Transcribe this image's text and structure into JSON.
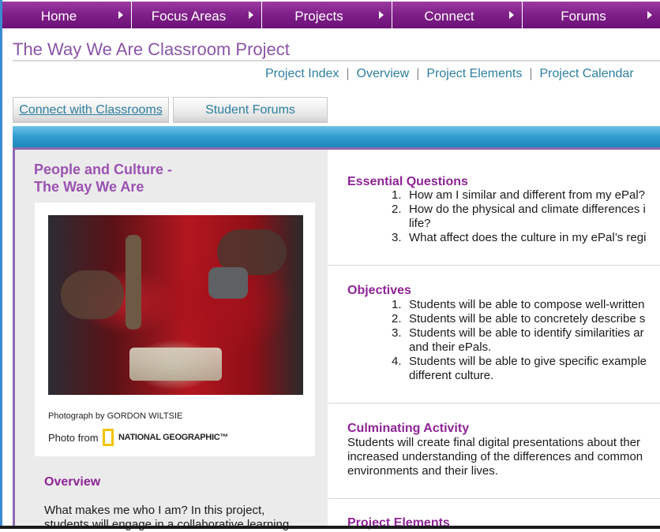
{
  "nav": {
    "items": [
      {
        "label": "Home"
      },
      {
        "label": "Focus Areas"
      },
      {
        "label": "Projects"
      },
      {
        "label": "Connect"
      },
      {
        "label": "Forums"
      }
    ]
  },
  "page": {
    "title": "The Way We Are Classroom Project"
  },
  "subnav": [
    "Project Index",
    "Overview",
    "Project Elements",
    "Project Calendar"
  ],
  "subnav_separator": "|",
  "tabs": [
    "Connect with Classrooms",
    "Student Forums"
  ],
  "left": {
    "heading_line1": "People and Culture -",
    "heading_line2": "The Way We Are",
    "photo_credit": "Photograph by GORDON WILTSIE",
    "photo_from": "Photo from",
    "logo_text": "NATIONAL GEOGRAPHIC™",
    "overview_heading": "Overview",
    "overview_text": "What makes me who I am? In this project, students will engage in a collaborative learning"
  },
  "right": {
    "essential": {
      "heading": "Essential Questions",
      "items": [
        {
          "num": "1.",
          "text": "How am I similar and different from my ePal?"
        },
        {
          "num": "2.",
          "text": "How do the physical and climate differences i",
          "cont": "life?"
        },
        {
          "num": "3.",
          "text": "What affect does the culture in my ePal’s regi"
        }
      ]
    },
    "objectives": {
      "heading": "Objectives",
      "items": [
        {
          "num": "1.",
          "text": "Students will be able to compose well-written"
        },
        {
          "num": "2.",
          "text": "Students will be able to concretely describe s"
        },
        {
          "num": "3.",
          "text": "Students will be able to identify similarities ar",
          "cont": "and their ePals."
        },
        {
          "num": "4.",
          "text": "Students will be able to give specific example",
          "cont": "different culture."
        }
      ]
    },
    "culminating": {
      "heading": "Culminating Activity",
      "lines": [
        "Students will create final digital presentations about ther",
        "increased understanding of the differences and common",
        "environments and their lives."
      ]
    },
    "elements": {
      "heading": "Project Elements"
    }
  },
  "colors": {
    "nav_purple": "#7e1e88",
    "title_purple": "#8a55a6",
    "heading_purple": "#8e2496",
    "link_teal": "#2e7fa0",
    "bar_blue": "#2f9ccf"
  }
}
